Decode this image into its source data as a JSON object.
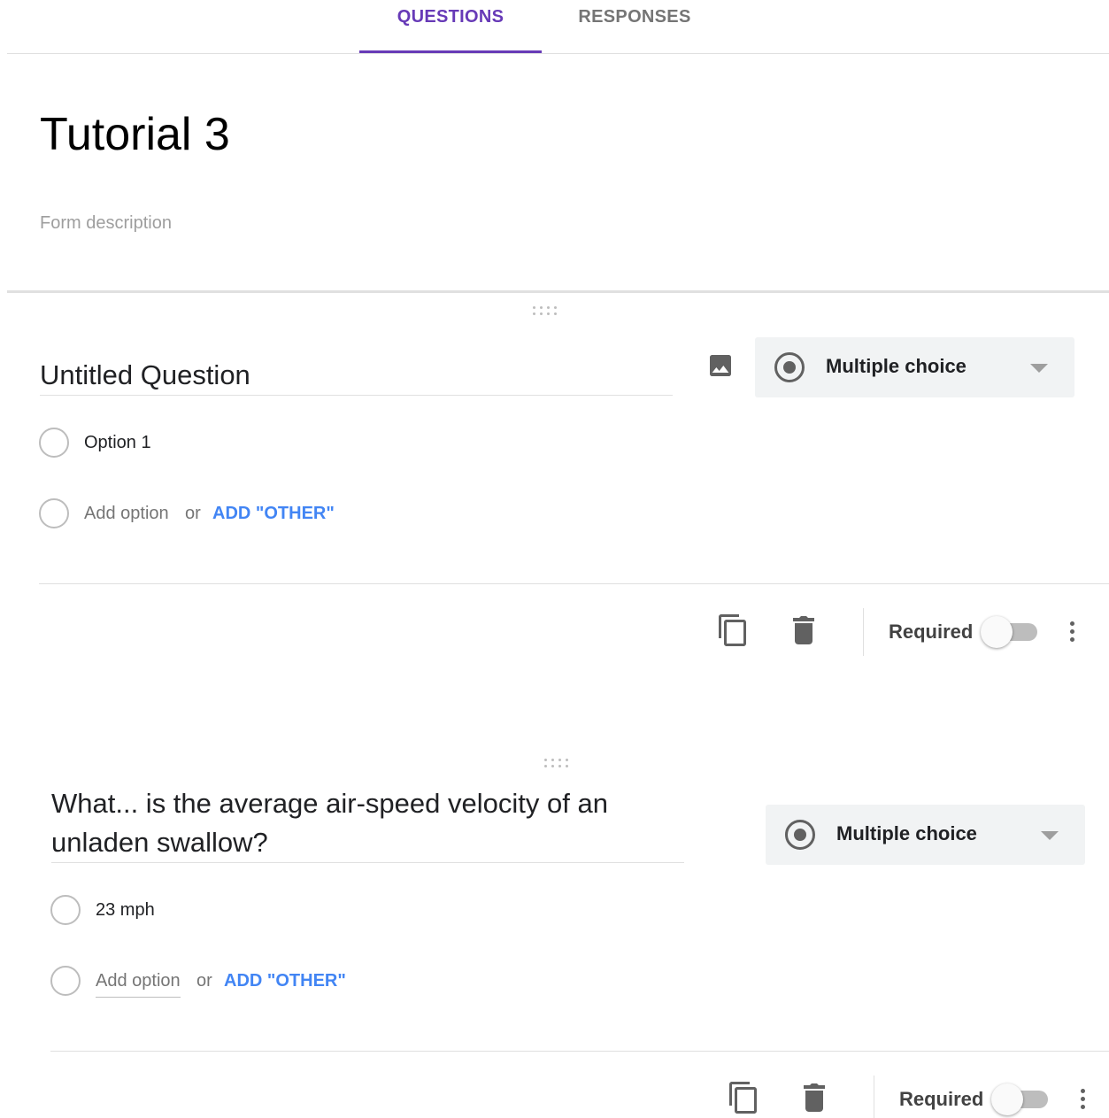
{
  "tabs": {
    "questions_label": "QUESTIONS",
    "responses_label": "RESPONSES",
    "active": "questions"
  },
  "form": {
    "title": "Tutorial 3",
    "description_placeholder": "Form description"
  },
  "questions": [
    {
      "title": "Untitled Question",
      "type": "Multiple choice",
      "options": [
        "Option 1"
      ],
      "add_option_label": "Add option",
      "or_label": "or",
      "add_other_label": "ADD \"OTHER\"",
      "required_label": "Required",
      "required": false
    },
    {
      "title": "What... is the average air-speed velocity of an unladen swallow?",
      "type": "Multiple choice",
      "options": [
        "23 mph"
      ],
      "add_option_label": "Add option",
      "or_label": "or",
      "add_other_label": "ADD \"OTHER\"",
      "required_label": "Required",
      "required": false
    }
  ],
  "colors": {
    "accent": "#673ab7",
    "link": "#4285f4",
    "inactive_tab": "#757575"
  },
  "icons": [
    "drag-handle-icon",
    "image-icon",
    "radio-button-icon",
    "dropdown-caret-icon",
    "duplicate-icon",
    "delete-icon",
    "more-vert-icon"
  ]
}
